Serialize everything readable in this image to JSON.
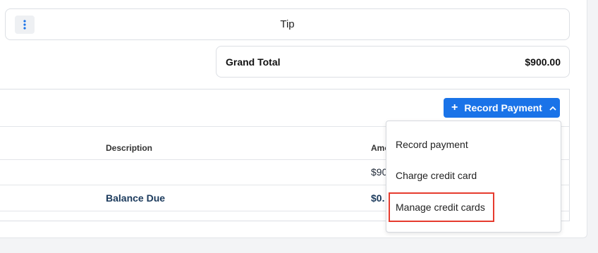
{
  "tip": {
    "label": "Tip"
  },
  "grand_total": {
    "label": "Grand Total",
    "value": "$900.00"
  },
  "record_payment": {
    "label": "Record Payment",
    "plus": "+"
  },
  "table": {
    "headers": {
      "description": "Description",
      "amount": "Amo"
    },
    "rows": [
      {
        "description": "",
        "amount": "$90"
      },
      {
        "description": "Balance Due",
        "amount": "$0."
      }
    ]
  },
  "dropdown": {
    "items": [
      "Record payment",
      "Charge credit card",
      "Manage credit cards"
    ]
  },
  "colors": {
    "accent": "#1a73e8",
    "balance_text": "#1b3a5c",
    "highlight": "#e63b2e"
  }
}
